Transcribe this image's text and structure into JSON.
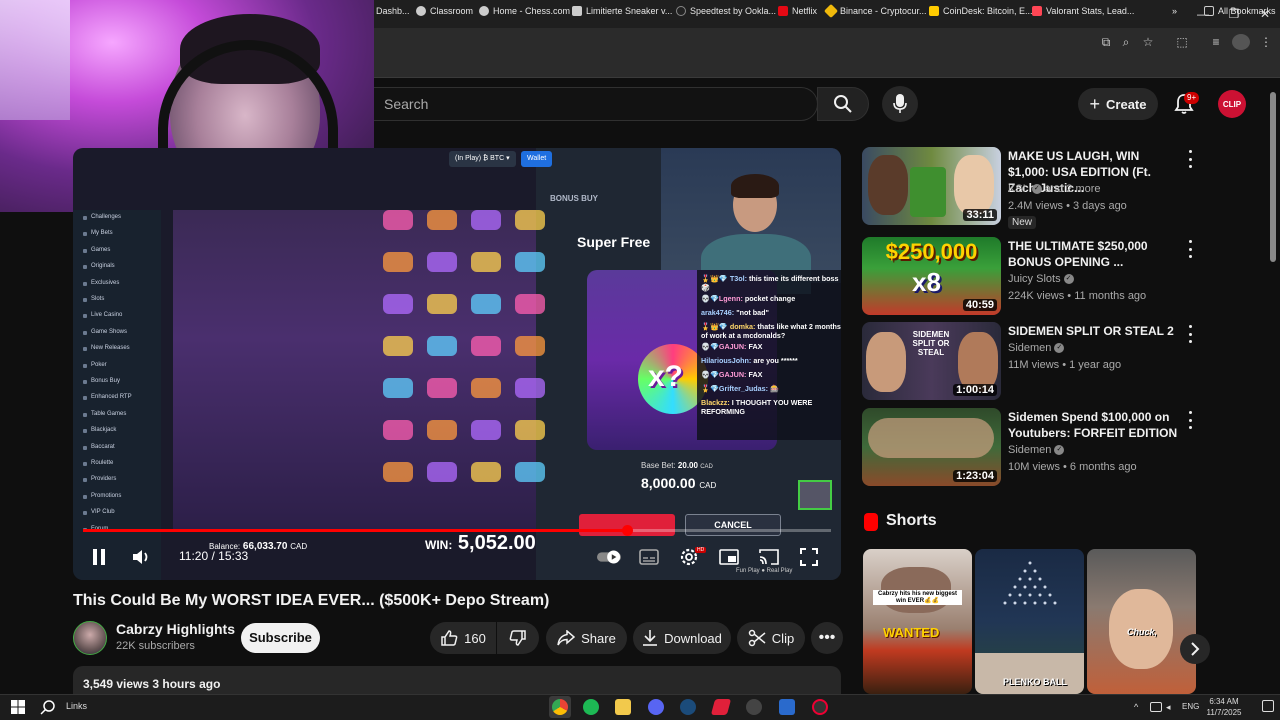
{
  "window": {
    "minimize": "—",
    "restore": "❐",
    "close": "✕"
  },
  "bookmarks": [
    {
      "label": "Dashb...",
      "color": "#4285f4"
    },
    {
      "label": "Classroom",
      "color": "#cccccc"
    },
    {
      "label": "Home - Chess.com",
      "color": "#cccccc"
    },
    {
      "label": "Limitierte Sneaker v...",
      "color": "#cccccc"
    },
    {
      "label": "Speedtest by Ookla...",
      "color": "#222222"
    },
    {
      "label": "Netflix",
      "color": "#e50914"
    },
    {
      "label": "Binance - Cryptocur...",
      "color": "#f0b90b"
    },
    {
      "label": "CoinDesk: Bitcoin, E...",
      "color": "#ffcc00"
    },
    {
      "label": "Valorant Stats, Lead...",
      "color": "#ff4655"
    }
  ],
  "all_bookmarks": "All Bookmarks",
  "header": {
    "search_placeholder": "Search",
    "create_label": "Create",
    "notif_count": "9+",
    "avatar_text": "CLIP"
  },
  "player": {
    "casino_menu": [
      "Challenges",
      "My Bets",
      "Games",
      "Originals",
      "Exclusives",
      "Slots",
      "Live Casino",
      "Game Shows",
      "New Releases",
      "Poker",
      "Bonus Buy",
      "Enhanced RTP",
      "Table Games",
      "Blackjack",
      "Baccarat",
      "Roulette",
      "Providers",
      "Promotions",
      "VIP Club",
      "Forum"
    ],
    "in_play": "(In Play) ₿ BTC ▾",
    "wallet": "Wallet",
    "bonus_buy": "BONUS BUY",
    "super_free": "Super Free",
    "chat": [
      {
        "user": "🎖️👑💎 T3ol:",
        "msg": "this time its different boss 🎲",
        "cls": "chat-user"
      },
      {
        "user": "💀💎Lgenn:",
        "msg": "pocket change",
        "cls": "chat-user2"
      },
      {
        "user": "arak4746:",
        "msg": "\"not bad\"",
        "cls": "chat-user"
      },
      {
        "user": "🎖️👑💎 domka:",
        "msg": "thats like what 2 months of work at a mcdonalds?",
        "cls": "chat-user3"
      },
      {
        "user": "💀💎GAJUN:",
        "msg": "FAX",
        "cls": "chat-user2"
      },
      {
        "user": "HilariousJohn:",
        "msg": "are you ******",
        "cls": "chat-user"
      },
      {
        "user": "💀💎GAJUN:",
        "msg": "FAX",
        "cls": "chat-user2"
      },
      {
        "user": "🎖️💎Grifter_Judas:",
        "msg": "🎰",
        "cls": "chat-user"
      },
      {
        "user": "Blackzz:",
        "msg": "I THOUGHT YOU WERE REFORMING",
        "cls": "chat-user3"
      }
    ],
    "base_bet_label": "Base Bet:",
    "base_bet_value": "20.00",
    "base_bet_currency": "CAD",
    "bet_amount": "8,000.00",
    "bet_currency": "CAD",
    "cancel": "CANCEL",
    "balance_label": "Balance:",
    "balance_value": "66,033.70",
    "balance_currency": "CAD",
    "win_label": "WIN:",
    "win_value": "5,052.00",
    "fun_real": "Fun Play ● Real Play",
    "timecode": "11:20 / 15:33",
    "progress": 0.727,
    "hd": "HD"
  },
  "video": {
    "title": "This Could Be My WORST IDEA EVER... ($500K+ Depo Stream)",
    "channel": "Cabrzy Highlights",
    "subscribers": "22K subscribers",
    "subscribe": "Subscribe",
    "likes": "160",
    "share": "Share",
    "download": "Download",
    "clip": "Clip",
    "views_line": "3,549 views  3 hours ago"
  },
  "recommendations": [
    {
      "title": "MAKE US LAUGH, WIN $1,000: USA EDITION (Ft. Zach Justic...",
      "channel": "KSI",
      "channel_extra": "and 2 more",
      "meta": "2.4M views • 3 days ago",
      "duration": "33:11",
      "badge": "New",
      "verified": false
    },
    {
      "title": "THE ULTIMATE $250,000 BONUS OPENING ...",
      "channel": "Juicy Slots",
      "channel_extra": "",
      "meta": "224K views • 11 months ago",
      "duration": "40:59",
      "badge": "",
      "verified": true
    },
    {
      "title": "SIDEMEN SPLIT OR STEAL 2",
      "channel": "Sidemen",
      "channel_extra": "",
      "meta": "11M views • 1 year ago",
      "duration": "1:00:14",
      "badge": "",
      "verified": true
    },
    {
      "title": "Sidemen Spend $100,000 on Youtubers: FORFEIT EDITION",
      "channel": "Sidemen",
      "channel_extra": "",
      "meta": "10M views • 6 months ago",
      "duration": "1:23:04",
      "badge": "",
      "verified": true
    }
  ],
  "thumb_text": {
    "rec2": "$250,000",
    "rec2_x": "x8",
    "rec3": "SIDEMEN SPLIT OR STEAL"
  },
  "shorts": {
    "label": "Shorts",
    "s1_caption": "Cabrzy hits his new biggest win EVER💰💰",
    "s1_bottom": "WANTED",
    "s2_caption": "PLENKO BALL",
    "s3_caption": "Chuck,"
  },
  "taskbar": {
    "links": "Links",
    "lang": "ENG",
    "time": "6:34 AM",
    "date": "11/7/2025"
  }
}
